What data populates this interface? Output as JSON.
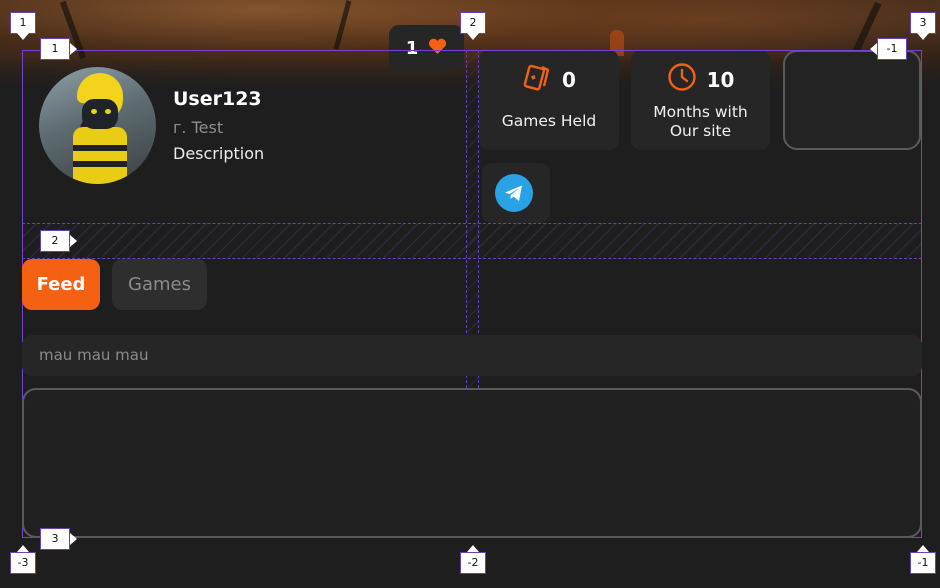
{
  "likes": {
    "count": "1",
    "icon": "heart-icon",
    "color": "#f46113"
  },
  "profile": {
    "username": "User123",
    "city": "г. Test",
    "description": "Description"
  },
  "stats": [
    {
      "icon": "cards-icon",
      "value": "0",
      "label": "Games Held"
    },
    {
      "icon": "clock-icon",
      "value": "10",
      "label_line1": "Months with",
      "label_line2": "Our site"
    }
  ],
  "social": {
    "icon": "telegram-icon",
    "color": "#2aa3e6"
  },
  "tabs": {
    "feed": "Feed",
    "games": "Games"
  },
  "post_input": {
    "text": "mau mau mau"
  },
  "accent_color": "#f46113",
  "guide_markers": {
    "top_columns": [
      "1",
      "2",
      "3"
    ],
    "left_rows": [
      "1",
      "2",
      "3"
    ],
    "right_row": "-1",
    "bottom_columns": [
      "-3",
      "-2",
      "-1"
    ]
  }
}
